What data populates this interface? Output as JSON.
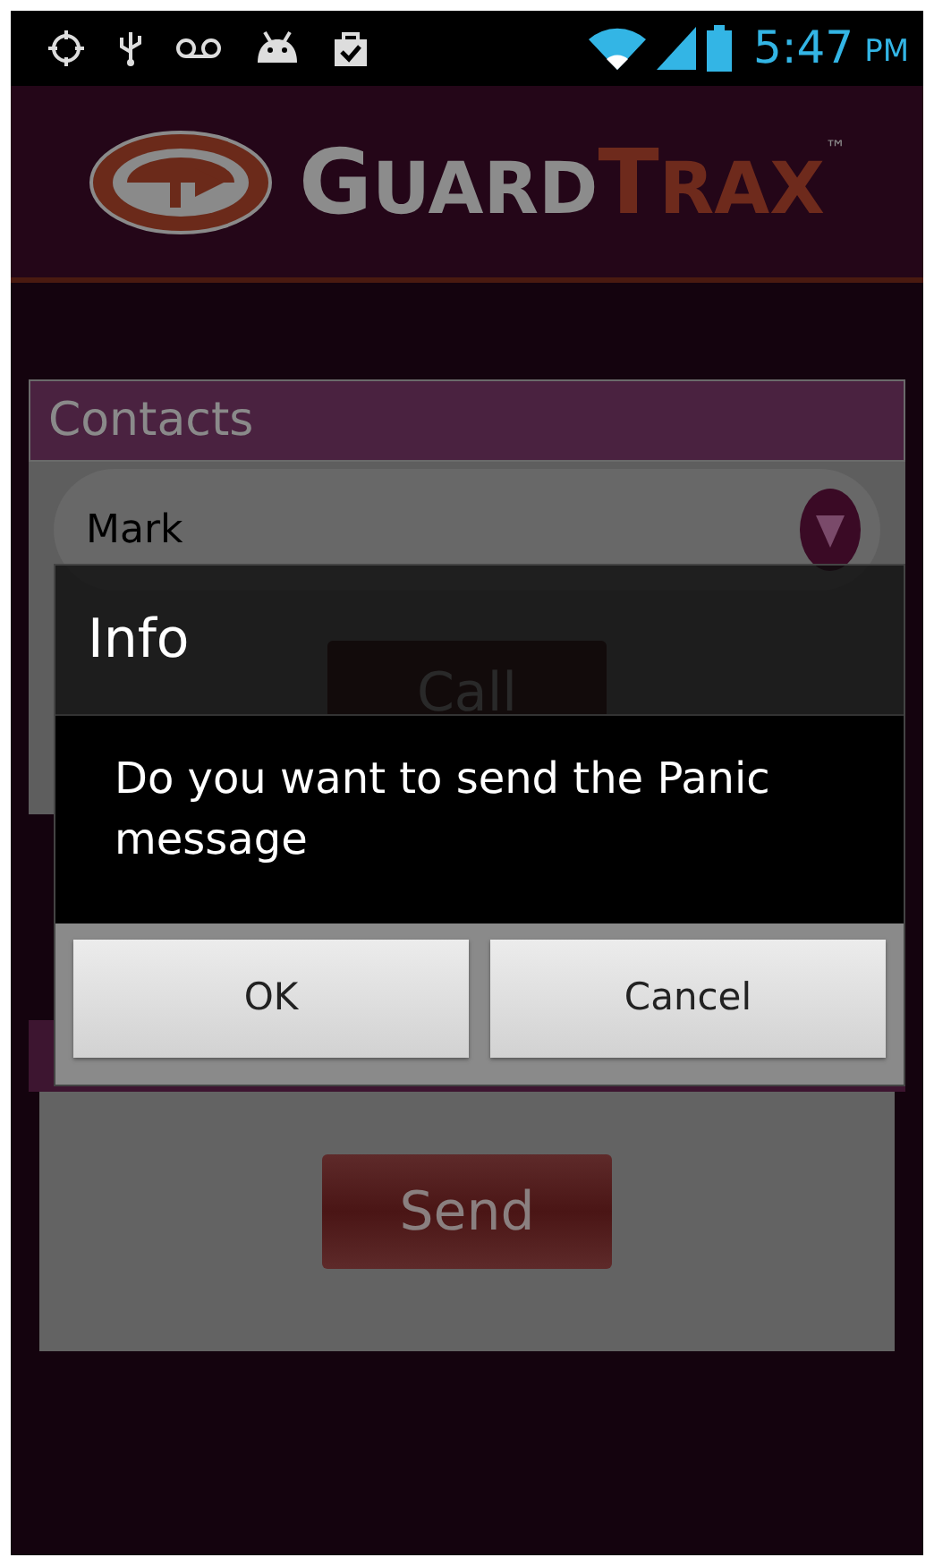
{
  "status_bar": {
    "time": "5:47",
    "ampm": "PM"
  },
  "logo": {
    "parts": [
      {
        "text": "GUARD",
        "color": "#8c8c8c"
      },
      {
        "text": "TRAX",
        "color": "#6e2a1c"
      }
    ],
    "trademark": "™"
  },
  "contacts_panel": {
    "title": "Contacts",
    "selected_contact": "Mark",
    "call_button": "Call"
  },
  "panic_panel": {
    "send_button": "Send"
  },
  "dialog": {
    "title": "Info",
    "message": "Do you want to send the Panic message",
    "buttons": [
      {
        "label": "OK"
      },
      {
        "label": "Cancel"
      }
    ]
  }
}
